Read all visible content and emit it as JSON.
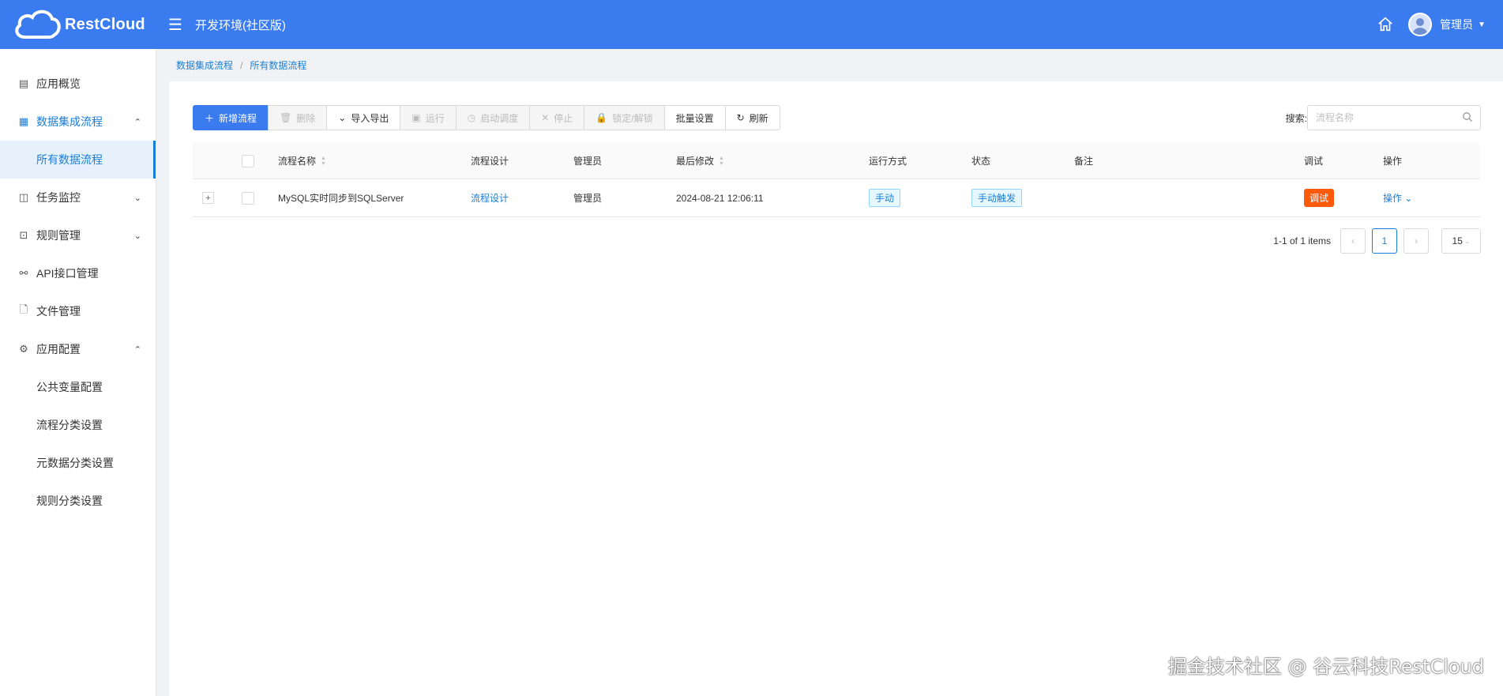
{
  "header": {
    "logo_text": "RestCloud",
    "env_title": "开发环境(社区版)",
    "user_name": "管理员",
    "colors": {
      "header_bg": "#3a7bef",
      "accent": "#1b7ed6",
      "danger": "#fa5a0a"
    }
  },
  "sidebar": {
    "items": [
      {
        "label": "应用概览",
        "icon": "dashboard-icon"
      },
      {
        "label": "数据集成流程",
        "icon": "grid-icon",
        "expanded": true
      },
      {
        "label": "所有数据流程",
        "sub": true,
        "active": true
      },
      {
        "label": "任务监控",
        "icon": "monitor-icon",
        "expanded": false
      },
      {
        "label": "规则管理",
        "icon": "terminal-icon",
        "expanded": false
      },
      {
        "label": "API接口管理",
        "icon": "api-icon"
      },
      {
        "label": "文件管理",
        "icon": "file-icon"
      },
      {
        "label": "应用配置",
        "icon": "gear-icon",
        "expanded": true
      },
      {
        "label": "公共变量配置",
        "sub": true
      },
      {
        "label": "流程分类设置",
        "sub": true
      },
      {
        "label": "元数据分类设置",
        "sub": true
      },
      {
        "label": "规则分类设置",
        "sub": true
      }
    ]
  },
  "breadcrumb": {
    "parent": "数据集成流程",
    "separator": "/",
    "current": "所有数据流程"
  },
  "toolbar": {
    "new": "新增流程",
    "delete": "删除",
    "import_export": "导入导出",
    "run": "运行",
    "schedule": "启动调度",
    "stop": "停止",
    "lock": "锁定/解锁",
    "batch": "批量设置",
    "refresh": "刷新"
  },
  "search": {
    "label": "搜索:",
    "placeholder": "流程名称"
  },
  "table": {
    "headers": {
      "name": "流程名称",
      "design": "流程设计",
      "admin": "管理员",
      "modified": "最后修改",
      "run_mode": "运行方式",
      "status": "状态",
      "remark": "备注",
      "debug": "调试",
      "ops": "操作"
    },
    "rows": [
      {
        "name": "MySQL实时同步到SQLServer",
        "design": "流程设计",
        "admin": "管理员",
        "modified": "2024-08-21 12:06:11",
        "run_mode": "手动",
        "status": "手动触发",
        "remark": "",
        "debug": "调试",
        "ops": "操作"
      }
    ]
  },
  "pagination": {
    "total_text": "1-1 of 1 items",
    "current_page": "1",
    "page_size": "15"
  },
  "watermark": "掘金技术社区 @ 谷云科技RestCloud"
}
